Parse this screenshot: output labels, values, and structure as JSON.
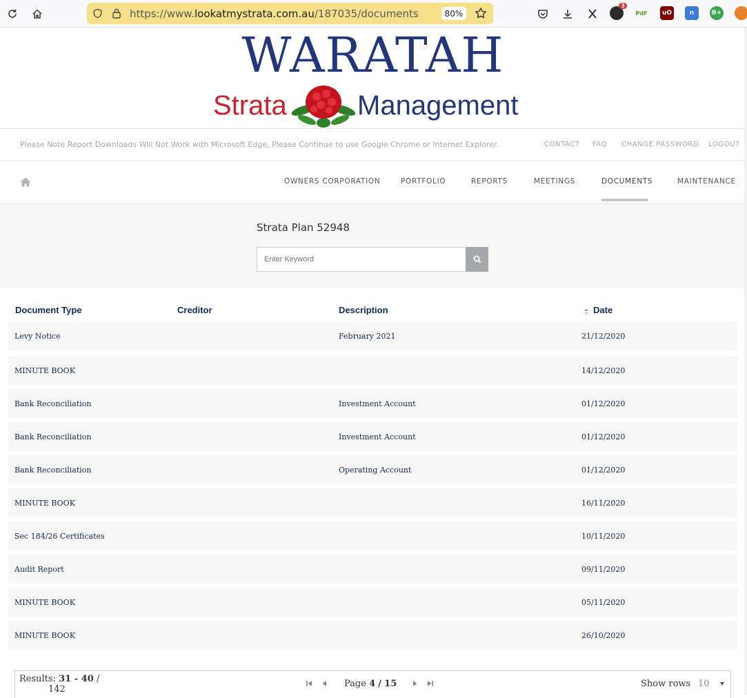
{
  "browser": {
    "url_prefix": "https://www.",
    "url_domain": "lookatmystrata.com.au",
    "url_path": "/187035/documents",
    "zoom": "80%",
    "ext_badge_count": "3",
    "ext_pdf_label": "PdF",
    "ext_b_label": "B+"
  },
  "logo": {
    "line1": "WARATAH",
    "word_left": "Strata",
    "word_right": "Management",
    "colors": {
      "blue": "#23367a",
      "red": "#d0202e"
    }
  },
  "notice": {
    "text": "Please Note Report Downloads Will Not Work with Microsoft Edge, Please Continue to use Google Chrome or Internet Explorer.",
    "links": [
      "CONTACT",
      "FAQ",
      "CHANGE PASSWORD",
      "LOGOUT"
    ]
  },
  "nav": {
    "items": [
      "OWNERS CORPORATION",
      "PORTFOLIO",
      "REPORTS",
      "MEETINGS",
      "DOCUMENTS",
      "MAINTENANCE"
    ],
    "active": "DOCUMENTS"
  },
  "search": {
    "plan_title": "Strata Plan 52948",
    "placeholder": "Enter Keyword",
    "value": ""
  },
  "table": {
    "headers": [
      "Document Type",
      "Creditor",
      "Description",
      "Date"
    ],
    "rows": [
      {
        "type": "Levy Notice",
        "creditor": "",
        "description": "February 2021",
        "date": "21/12/2020"
      },
      {
        "type": "MINUTE BOOK",
        "creditor": "",
        "description": "",
        "date": "14/12/2020"
      },
      {
        "type": "Bank Reconciliation",
        "creditor": "",
        "description": "Investment Account",
        "date": "01/12/2020"
      },
      {
        "type": "Bank Reconciliation",
        "creditor": "",
        "description": "Investment Account",
        "date": "01/12/2020"
      },
      {
        "type": "Bank Reconciliation",
        "creditor": "",
        "description": "Operating Account",
        "date": "01/12/2020"
      },
      {
        "type": "MINUTE BOOK",
        "creditor": "",
        "description": "",
        "date": "16/11/2020"
      },
      {
        "type": "Sec 184/26 Certificates",
        "creditor": "",
        "description": "",
        "date": "10/11/2020"
      },
      {
        "type": "Audit Report",
        "creditor": "",
        "description": "",
        "date": "09/11/2020"
      },
      {
        "type": "MINUTE BOOK",
        "creditor": "",
        "description": "",
        "date": "05/11/2020"
      },
      {
        "type": "MINUTE BOOK",
        "creditor": "",
        "description": "",
        "date": "26/10/2020"
      }
    ]
  },
  "pager": {
    "results_label": "Results:",
    "results_range": "31 - 40",
    "results_sep": "/",
    "results_total": "142",
    "page_label": "Page",
    "page_current": "4",
    "page_sep": "/",
    "page_total": "15",
    "show_rows_label": "Show rows",
    "rows_value": "10"
  }
}
